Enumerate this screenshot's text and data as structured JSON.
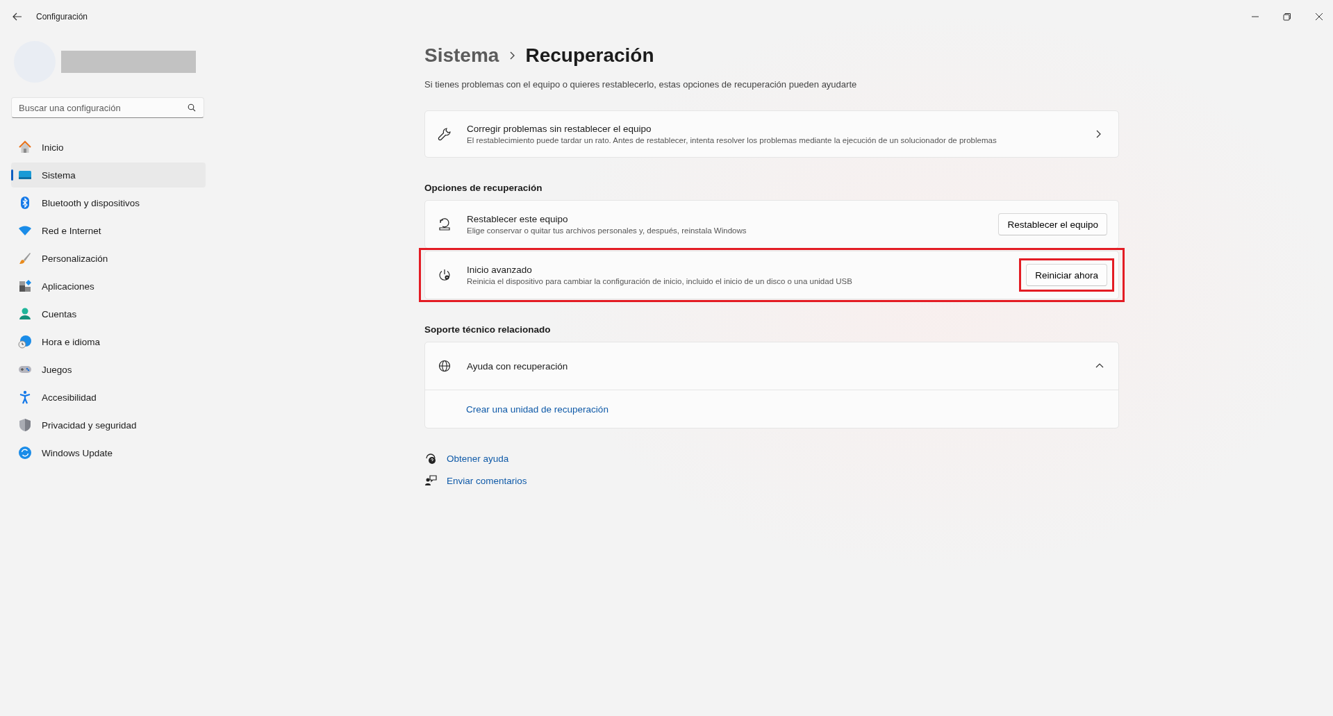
{
  "window": {
    "title": "Configuración"
  },
  "sidebar": {
    "search": {
      "placeholder": "Buscar una configuración"
    },
    "items": [
      {
        "label": "Inicio",
        "kind": "home",
        "selected": false
      },
      {
        "label": "Sistema",
        "kind": "system",
        "selected": true
      },
      {
        "label": "Bluetooth y dispositivos",
        "kind": "bluetooth",
        "selected": false
      },
      {
        "label": "Red e Internet",
        "kind": "wifi",
        "selected": false
      },
      {
        "label": "Personalización",
        "kind": "brush",
        "selected": false
      },
      {
        "label": "Aplicaciones",
        "kind": "apps",
        "selected": false
      },
      {
        "label": "Cuentas",
        "kind": "person",
        "selected": false
      },
      {
        "label": "Hora e idioma",
        "kind": "clock",
        "selected": false
      },
      {
        "label": "Juegos",
        "kind": "gamepad",
        "selected": false
      },
      {
        "label": "Accesibilidad",
        "kind": "access",
        "selected": false
      },
      {
        "label": "Privacidad y seguridad",
        "kind": "shield",
        "selected": false
      },
      {
        "label": "Windows Update",
        "kind": "update",
        "selected": false
      }
    ]
  },
  "breadcrumb": [
    "Sistema",
    "Recuperación"
  ],
  "description": "Si tienes problemas con el equipo o quieres restablecerlo, estas opciones de recuperación pueden ayudarte",
  "fix_card": {
    "title": "Corregir problemas sin restablecer el equipo",
    "subtitle": "El restablecimiento puede tardar un rato. Antes de restablecer, intenta resolver los problemas mediante la ejecución de un solucionador de problemas"
  },
  "recovery_options": {
    "heading": "Opciones de recuperación",
    "items": [
      {
        "kind": "reset",
        "title": "Restablecer este equipo",
        "subtitle": "Elige conservar o quitar tus archivos personales y, después, reinstala Windows",
        "button": "Restablecer el equipo",
        "highlighted": false
      },
      {
        "kind": "startup",
        "title": "Inicio avanzado",
        "subtitle": "Reinicia el dispositivo para cambiar la configuración de inicio, incluido el inicio de un disco o una unidad USB",
        "button": "Reiniciar ahora",
        "highlighted": true
      }
    ]
  },
  "support": {
    "heading": "Soporte técnico relacionado",
    "title": "Ayuda con recuperación",
    "expanded": true,
    "link": "Crear una unidad de recuperación"
  },
  "footer_links": [
    {
      "kind": "help",
      "label": "Obtener ayuda"
    },
    {
      "kind": "feedback",
      "label": "Enviar comentarios"
    }
  ]
}
